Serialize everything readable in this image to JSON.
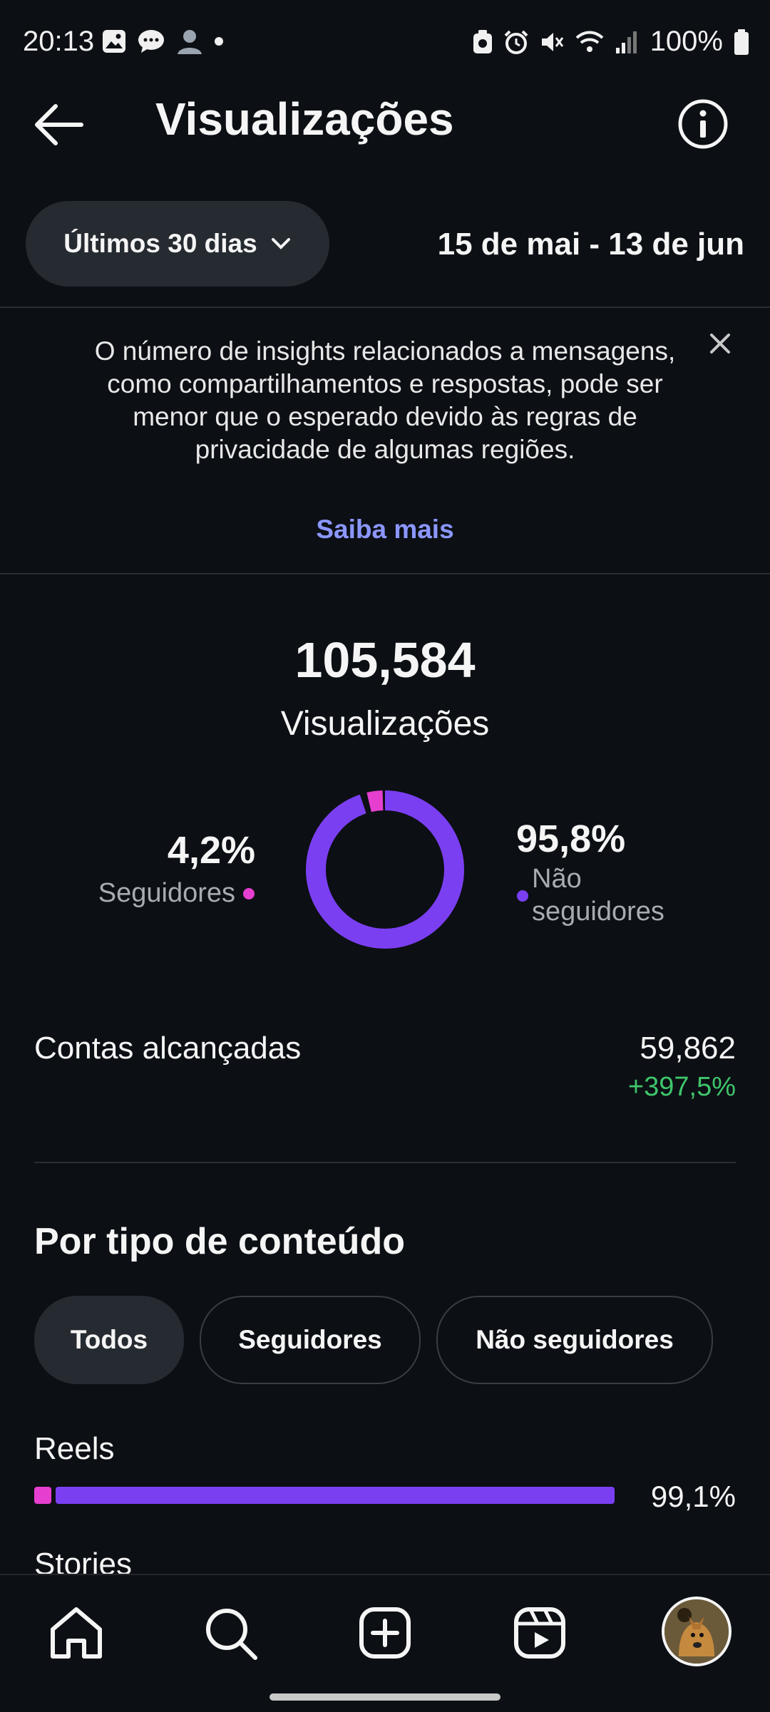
{
  "status_bar": {
    "time": "20:13",
    "battery": "100%"
  },
  "header": {
    "title": "Visualizações"
  },
  "filter": {
    "range_label": "Últimos 30 dias",
    "date_range": "15 de mai - 13 de jun"
  },
  "notice": {
    "text": "O número de insights relacionados a mensagens, como compartilhamentos e respostas, pode ser menor que o esperado devido às regras de privacidade de algumas regiões.",
    "link": "Saiba mais"
  },
  "summary": {
    "total": "105,584",
    "label": "Visualizações",
    "followers_pct": "4,2%",
    "followers_label": "Seguidores",
    "non_followers_pct": "95,8%",
    "non_followers_label_1": "Não",
    "non_followers_label_2": "seguidores",
    "followers_value": 4.2,
    "non_followers_value": 95.8
  },
  "reach": {
    "label": "Contas alcançadas",
    "value": "59,862",
    "change": "+397,5%"
  },
  "content_type": {
    "title": "Por tipo de conteúdo",
    "chips": [
      "Todos",
      "Seguidores",
      "Não seguidores"
    ],
    "rows": [
      {
        "label": "Reels",
        "pct": "99,1%",
        "followers_fraction": 0.03
      },
      {
        "label": "Stories"
      }
    ]
  },
  "colors": {
    "follower": "#e63fd0",
    "non_follower": "#7b3ff2",
    "positive": "#3ec56b",
    "link": "#8b97ff"
  },
  "nav": {
    "icons": [
      "home-icon",
      "search-icon",
      "create-icon",
      "reels-icon",
      "profile-avatar"
    ]
  }
}
